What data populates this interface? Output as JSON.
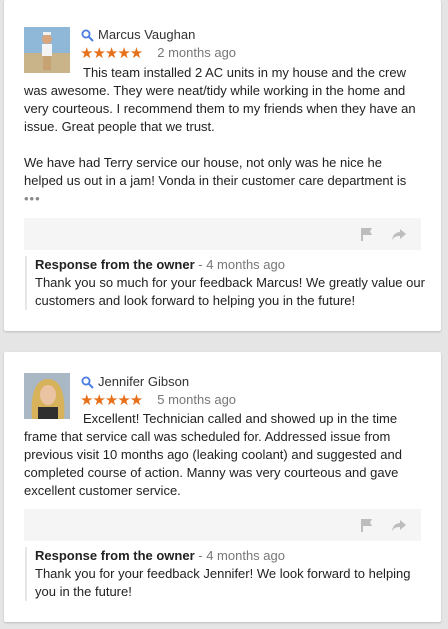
{
  "colors": {
    "star": "#e7711b",
    "search_icon": "#4a7de2",
    "action_icons": "#bdbdbd"
  },
  "reviews": [
    {
      "reviewer_name": "Marcus Vaughan",
      "stars": "★★★★★",
      "rating": 5,
      "date": "2 months ago",
      "text": "This team installed 2 AC units in my house and the crew was awesome. They were neat/tidy while working in the home and very courteous. I recommend them to my friends when they have an issue. Great people that we trust.\n\nWe have had Terry service our house, not only was he nice he helped us out in a jam! Vonda in their customer care department is",
      "more": "•••",
      "response": {
        "heading": "Response from the owner",
        "separator": " - ",
        "date": "4 months ago",
        "text": "Thank you so much for your feedback Marcus! We greatly value our customers and look forward to helping you in the future!"
      }
    },
    {
      "reviewer_name": "Jennifer Gibson",
      "stars": "★★★★★",
      "rating": 5,
      "date": "5 months ago",
      "text": "Excellent! Technician called and showed up in the time frame that service call was scheduled for. Addressed issue from previous visit 10 months ago (leaking coolant) and suggested and completed course of action. Manny was very courteous and gave excellent customer service.",
      "response": {
        "heading": "Response from the owner",
        "separator": " - ",
        "date": "4 months ago",
        "text": "Thank you for your feedback Jennifer! We look forward to helping you in the future!"
      }
    }
  ]
}
